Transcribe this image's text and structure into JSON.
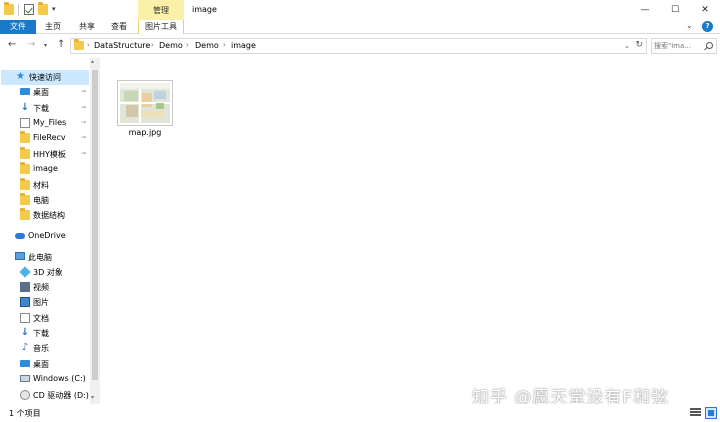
{
  "window": {
    "title": "image",
    "quick_access_dropdown": "▾",
    "minimize_glyph": "—",
    "maximize_glyph": "☐",
    "close_glyph": "✕"
  },
  "ribbon": {
    "context_group": "管理",
    "tabs": [
      {
        "label": "文件",
        "active": true
      },
      {
        "label": "主页"
      },
      {
        "label": "共享"
      },
      {
        "label": "查看"
      },
      {
        "label": "图片工具"
      }
    ],
    "expand_glyph": "⌄",
    "help_glyph": "?"
  },
  "navigation": {
    "back_glyph": "←",
    "forward_glyph": "→",
    "recent_glyph": "▾",
    "up_glyph": "↑",
    "breadcrumb": [
      "DataStructure",
      "Demo",
      "Demo",
      "image"
    ],
    "crumb_separator": "›",
    "address_dropdown": "⌄",
    "refresh_glyph": "↻",
    "search_placeholder": "搜索\"ima..."
  },
  "nav_pane": {
    "items": [
      {
        "label": "快速访问",
        "icon": "star-icon",
        "top": true,
        "selected": true
      },
      {
        "label": "桌面",
        "icon": "desktop-icon",
        "pinned": true
      },
      {
        "label": "下载",
        "icon": "download-icon",
        "pinned": true
      },
      {
        "label": "My_Files",
        "icon": "document-icon",
        "pinned": true
      },
      {
        "label": "FileRecv",
        "icon": "folder-icon",
        "pinned": true
      },
      {
        "label": "HHY模板",
        "icon": "folder-icon",
        "pinned": true
      },
      {
        "label": "image",
        "icon": "folder-icon"
      },
      {
        "label": "材料",
        "icon": "folder-icon"
      },
      {
        "label": "电脑",
        "icon": "folder-icon"
      },
      {
        "label": "数据结构",
        "icon": "folder-icon"
      },
      {
        "label": "OneDrive",
        "icon": "cloud-icon",
        "top": true
      },
      {
        "label": "此电脑",
        "icon": "computer-icon",
        "top": true
      },
      {
        "label": "3D 对象",
        "icon": "cube-icon"
      },
      {
        "label": "视频",
        "icon": "video-icon"
      },
      {
        "label": "图片",
        "icon": "picture-icon"
      },
      {
        "label": "文档",
        "icon": "document-icon"
      },
      {
        "label": "下载",
        "icon": "download-icon"
      },
      {
        "label": "音乐",
        "icon": "music-icon"
      },
      {
        "label": "桌面",
        "icon": "desktop-icon"
      },
      {
        "label": "Windows (C:)",
        "icon": "drive-icon"
      },
      {
        "label": "CD 驱动器 (D:)",
        "icon": "cd-drive-icon"
      }
    ],
    "pin_glyph": "📌",
    "scroll_up_glyph": "▴",
    "scroll_down_glyph": "▾"
  },
  "content": {
    "files": [
      {
        "name": "map.jpg",
        "type": "image"
      }
    ]
  },
  "watermark": "知乎 @愿天堂没有F和弦",
  "status": {
    "item_count": "1 个项目"
  },
  "colors": {
    "accent": "#1979ca",
    "context_tab": "#fbf0a8",
    "selection": "#cce8ff"
  }
}
